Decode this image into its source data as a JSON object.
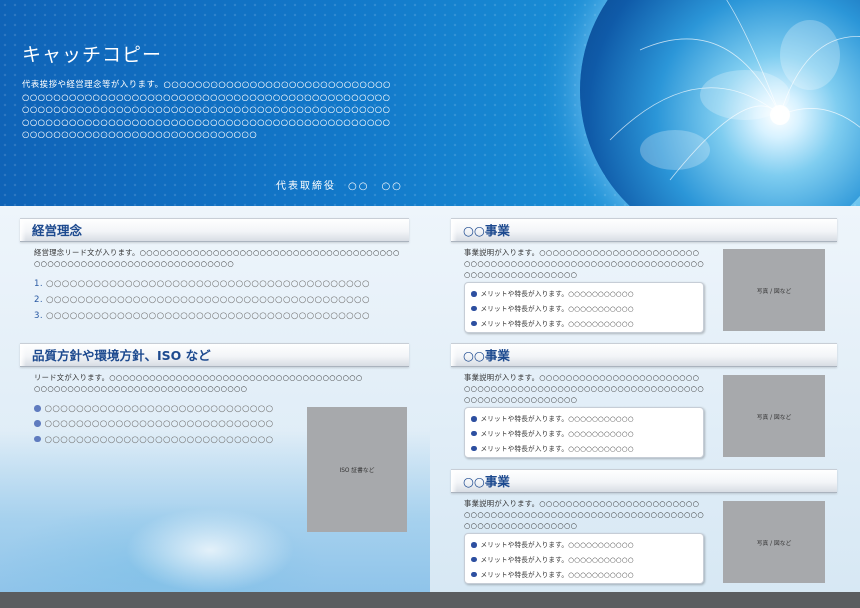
{
  "header": {
    "catchcopy": "キャッチコピー",
    "greeting": "代表挨拶や経営理念等が入ります。○○○○○○○○○○○○○○○○○○○○○○○○○○○○○○○○○○○○○○○○○○○○○○○○○○○○○○○○○○○○○○○○○○○○○○○○○○○○○○○○○○○○○○○○○○○○○○○○○○○○○○○○○○○○○○○○○○○○○○○○○○○○○○○○○○○○○○○○○○○○○○○○○○○○○○○○○○○○○○○○○○○○○○○○○○○○○○○○○○○○○○○○○○○○○○○○○○○○○○○○",
    "signature": "代表取締役　○○　○○"
  },
  "philosophy": {
    "title": "経営理念",
    "lead": "経営理念リード文が入ります。○○○○○○○○○○○○○○○○○○○○○○○○○○○○○○○○○○○○○○○○○○○○○○○○○○○○○○○○○○○○○○○○○○○○○",
    "items": [
      {
        "num": "1.",
        "text": "○○○○○○○○○○○○○○○○○○○○○○○○○○○○○○○○○○○○○○○○○"
      },
      {
        "num": "2.",
        "text": "○○○○○○○○○○○○○○○○○○○○○○○○○○○○○○○○○○○○○○○○○"
      },
      {
        "num": "3.",
        "text": "○○○○○○○○○○○○○○○○○○○○○○○○○○○○○○○○○○○○○○○○○"
      }
    ]
  },
  "policy": {
    "title": "品質方針や環境方針、ISO など",
    "lead": "リード文が入ります。○○○○○○○○○○○○○○○○○○○○○○○○○○○○○○○○○○○○○○○○○○○○○○○○○○○○○○○○○○○○○○○○○○○○○○",
    "items": [
      "○○○○○○○○○○○○○○○○○○○○○○○○○○○○○",
      "○○○○○○○○○○○○○○○○○○○○○○○○○○○○○",
      "○○○○○○○○○○○○○○○○○○○○○○○○○○○○○"
    ],
    "photo_label": "ISO 証書など"
  },
  "businesses": [
    {
      "title": "○○事業",
      "lead": "事業説明が入ります。○○○○○○○○○○○○○○○○○○○○○○○○○○○○○○○○○○○○○○○○○○○○○○○○○○○○○○○○○○○○○○○○○○○○○○○○○○○○○",
      "merits": [
        "メリットや特長が入ります。○○○○○○○○○○○",
        "メリットや特長が入ります。○○○○○○○○○○○",
        "メリットや特長が入ります。○○○○○○○○○○○"
      ],
      "photo_label": "写真 / 図など"
    },
    {
      "title": "○○事業",
      "lead": "事業説明が入ります。○○○○○○○○○○○○○○○○○○○○○○○○○○○○○○○○○○○○○○○○○○○○○○○○○○○○○○○○○○○○○○○○○○○○○○○○○○○○○",
      "merits": [
        "メリットや特長が入ります。○○○○○○○○○○○",
        "メリットや特長が入ります。○○○○○○○○○○○",
        "メリットや特長が入ります。○○○○○○○○○○○"
      ],
      "photo_label": "写真 / 図など"
    },
    {
      "title": "○○事業",
      "lead": "事業説明が入ります。○○○○○○○○○○○○○○○○○○○○○○○○○○○○○○○○○○○○○○○○○○○○○○○○○○○○○○○○○○○○○○○○○○○○○○○○○○○○○",
      "merits": [
        "メリットや特長が入ります。○○○○○○○○○○○",
        "メリットや特長が入ります。○○○○○○○○○○○",
        "メリットや特長が入ります。○○○○○○○○○○○"
      ],
      "photo_label": "写真 / 図など"
    }
  ],
  "colors": {
    "header_blue": "#1278c9",
    "heading_text": "#1d4a8f",
    "bullet": "#5f7bbf",
    "placeholder_gray": "#a7a9ac",
    "footer": "#5b5d60"
  }
}
